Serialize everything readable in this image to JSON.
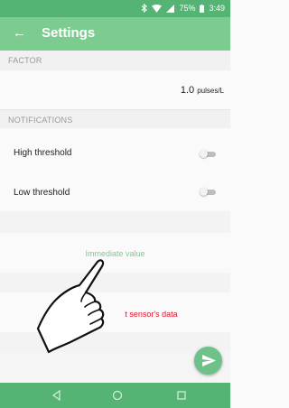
{
  "status_bar": {
    "battery_percent": "75%",
    "time": "3:49"
  },
  "app_bar": {
    "back_icon": "arrow-left-icon",
    "title": "Settings"
  },
  "factor": {
    "header": "FACTOR",
    "value": "1.0",
    "unit": "pulses/L"
  },
  "notifications": {
    "header": "NOTIFICATIONS",
    "high_threshold": {
      "label": "High threshold",
      "enabled": false
    },
    "low_threshold": {
      "label": "Low threshold",
      "enabled": false
    }
  },
  "actions": {
    "immediate_value": "Immediate value",
    "reset_sensor_data": "t sensor's data"
  },
  "colors": {
    "primary": "#7ccc8f",
    "primary_dark": "#55b473",
    "accent": "#6ec289",
    "danger": "#e8102a"
  },
  "fab": {
    "icon": "send-icon"
  },
  "nav_bar": {
    "back_icon": "triangle-back-icon",
    "home_icon": "circle-home-icon",
    "recents_icon": "square-recents-icon"
  }
}
